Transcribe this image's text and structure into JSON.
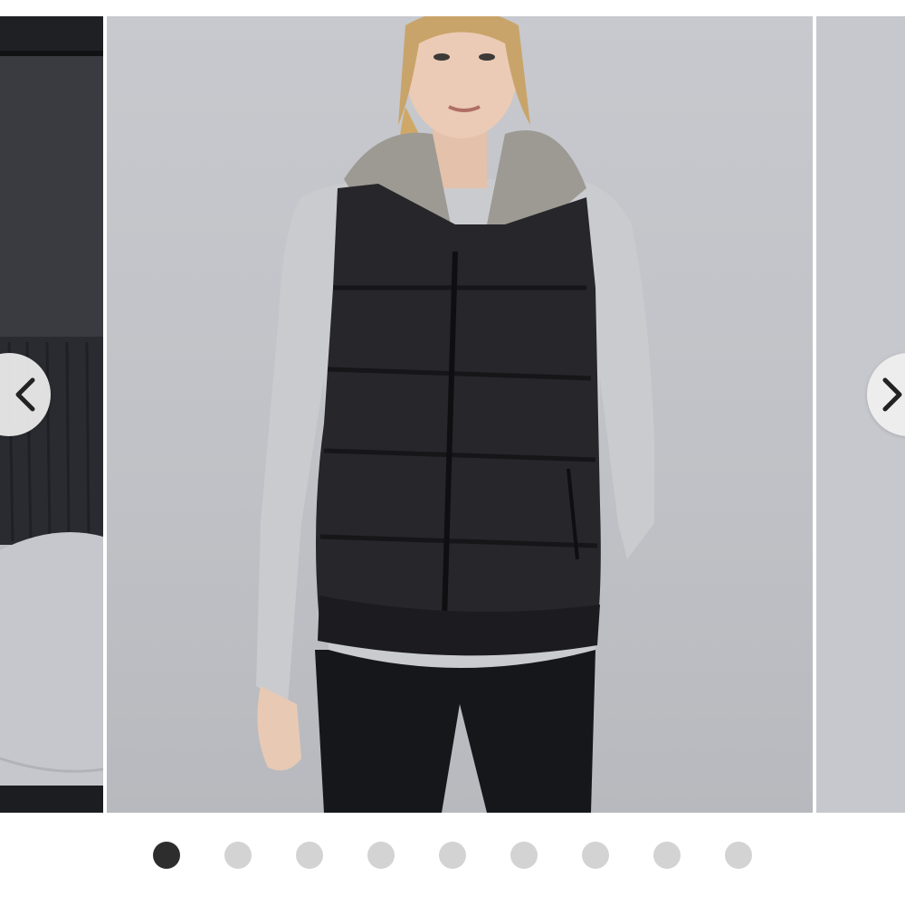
{
  "carousel": {
    "slides": [
      {
        "name": "slide-previous-detail",
        "description": ""
      },
      {
        "name": "slide-main-vest",
        "description": ""
      },
      {
        "name": "slide-next",
        "description": ""
      }
    ],
    "prev_icon": "chevron-left-icon",
    "next_icon": "chevron-right-icon",
    "colors": {
      "background": "#ffffff",
      "photo_backdrop": "#c4c6cb",
      "vest": "#26262b",
      "sweater": "#c9cbcf",
      "dot_active": "#2d2d2d",
      "dot_inactive": "#d3d3d3",
      "nav_button": "#f0f0f0"
    },
    "pagination": {
      "total": 9,
      "active_index": 0
    }
  }
}
